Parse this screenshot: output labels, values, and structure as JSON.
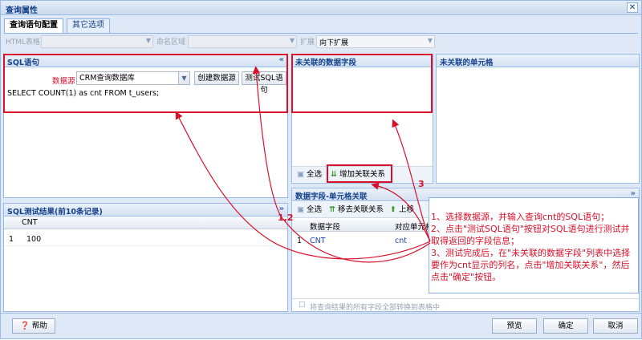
{
  "window": {
    "title": "查询属性"
  },
  "tabs": [
    {
      "label": "查询语句配置"
    },
    {
      "label": "其它选项"
    }
  ],
  "filters": {
    "html_table_label": "HTML表格",
    "named_area_label": "命名区域",
    "expand_label": "扩展",
    "expand_value": "向下扩展"
  },
  "sql_panel": {
    "title": "SQL语句",
    "datasource_label": "数据源",
    "datasource_value": "CRM查询数据库",
    "create_button": "创建数据源",
    "test_button": "测试SQL语句",
    "sql_text": "SELECT COUNT(1) as cnt FROM t_users;"
  },
  "unlinked_fields_panel": {
    "title": "未关联的数据字段",
    "select_all": "全选",
    "add_link": "增加关联关系"
  },
  "unlinked_cells_panel": {
    "title": "未关联的单元格"
  },
  "test_result_panel": {
    "title": "SQL测试结果(前10条记录)",
    "columns": [
      "CNT"
    ],
    "rows": [
      {
        "num": "1",
        "cnt": "100"
      }
    ]
  },
  "mapping_panel": {
    "title": "数据字段-单元格关联",
    "select_all": "全选",
    "remove_link": "移去关联关系",
    "move_up": "上移",
    "columns": [
      "数据字段",
      "对应单元格"
    ],
    "rows": [
      {
        "num": "1",
        "field": "CNT",
        "cell": "cnt"
      }
    ],
    "convert_label": "将查询结果的所有字段全部转换到表格中"
  },
  "annotations": {
    "arrow_label_12": "1,2",
    "arrow_label_3": "3",
    "callout_text": "1、选择数据源，并输入查询cnt的SQL语句；\n2、点击\"测试SQL语句\"按钮对SQL语句进行测试并取得返回的字段信息；\n3、测试完成后，在\"未关联的数据字段\"列表中选择要作为cnt显示的列名，点击\"增加关联关系\"，然后点击\"确定\"按钮。"
  },
  "footer": {
    "help": "帮助",
    "preview": "预览",
    "ok": "确定",
    "cancel": "取消"
  },
  "colors": {
    "accent": "#15428b",
    "annotation": "#d9102a",
    "border": "#99bbe8"
  }
}
